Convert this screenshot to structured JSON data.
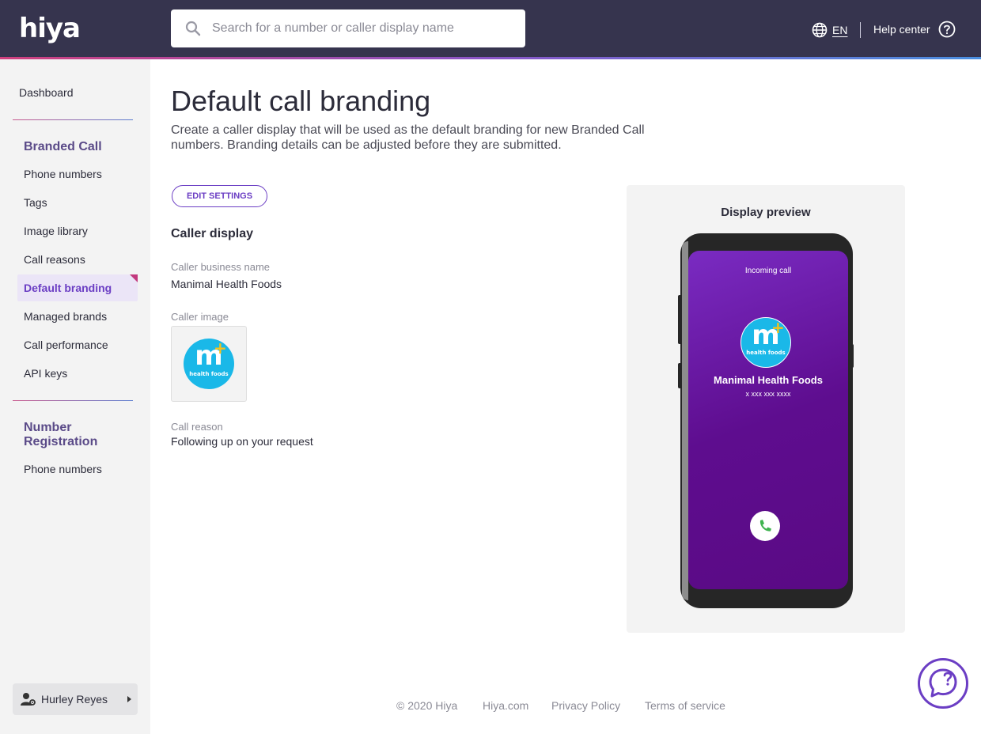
{
  "header": {
    "logo_text": "hiya",
    "search_placeholder": "Search for a number or caller display name",
    "language": "EN",
    "help_label": "Help center"
  },
  "sidebar": {
    "dashboard": "Dashboard",
    "branded_call_heading": "Branded Call",
    "branded_items": [
      {
        "label": "Phone numbers"
      },
      {
        "label": "Tags"
      },
      {
        "label": "Image library"
      },
      {
        "label": "Call reasons"
      },
      {
        "label": "Default branding",
        "active": true
      },
      {
        "label": "Managed brands"
      },
      {
        "label": "Call performance"
      },
      {
        "label": "API keys"
      }
    ],
    "number_registration_heading": "Number Registration",
    "registration_items": [
      {
        "label": "Phone numbers"
      }
    ],
    "user_name": "Hurley Reyes"
  },
  "main": {
    "title": "Default call branding",
    "description": "Create a caller display that will be used as the default branding for new Branded Call numbers. Branding details can be adjusted before they are submitted.",
    "edit_button": "EDIT SETTINGS",
    "section_title": "Caller display",
    "business_name_label": "Caller business name",
    "business_name_value": "Manimal Health Foods",
    "caller_image_label": "Caller image",
    "call_reason_label": "Call reason",
    "call_reason_value": "Following up on your request"
  },
  "brand_logo": {
    "letter": "m",
    "plus": "+",
    "subtext": "health foods",
    "color": "#1ab8e8"
  },
  "preview": {
    "title": "Display preview",
    "incoming_label": "Incoming call",
    "caller_name": "Manimal Health Foods",
    "caller_number": "x xxx xxx xxxx"
  },
  "footer": {
    "copyright": "© 2020 Hiya",
    "site": "Hiya.com",
    "privacy": "Privacy Policy",
    "terms": "Terms of service"
  },
  "colors": {
    "header_bg": "#36344e",
    "accent": "#6b3ec4",
    "sidebar_bg": "#f3f3f3"
  },
  "icons": [
    "search-icon",
    "globe-icon",
    "help-circle-icon",
    "user-settings-icon",
    "caret-right-icon",
    "phone-icon",
    "chat-icon"
  ]
}
